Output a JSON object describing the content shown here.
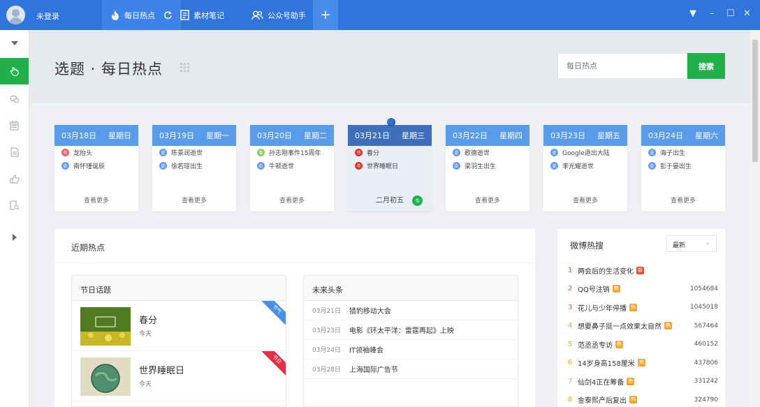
{
  "topbar": {
    "user": "未登录",
    "tabs": [
      {
        "label": "每日热点",
        "icon": "flame-icon"
      },
      {
        "label": "素材笔记",
        "icon": "note-icon"
      },
      {
        "label": "公众号助手",
        "icon": "users-icon"
      }
    ],
    "plus": "+",
    "window_controls": [
      "▼",
      "–",
      "☐",
      "✕"
    ]
  },
  "sidebar": {
    "items": [
      {
        "name": "collapse-arrow",
        "glyph": "▾"
      },
      {
        "name": "hot-topics",
        "glyph": "♨"
      },
      {
        "name": "chat",
        "glyph": "💬"
      },
      {
        "name": "calendar",
        "glyph": "📅"
      },
      {
        "name": "document",
        "glyph": "🗎"
      },
      {
        "name": "like",
        "glyph": "👍"
      },
      {
        "name": "search-doc",
        "glyph": "🔍"
      },
      {
        "name": "expand-arrow",
        "glyph": "▸"
      }
    ]
  },
  "header": {
    "title": "选题 · 每日热点",
    "search_placeholder": "每日热点",
    "search_button": "搜索"
  },
  "calendar": [
    {
      "date": "03月18日",
      "weekday": "星期日",
      "items": [
        {
          "badge": "节",
          "type": "jie",
          "text": "龙抬头"
        },
        {
          "badge": "史",
          "type": "shi",
          "text": "南怀瑾诞辰"
        }
      ],
      "more": "查看更多"
    },
    {
      "date": "03月19日",
      "weekday": "星期一",
      "items": [
        {
          "badge": "史",
          "type": "shi",
          "text": "陈景润逝世"
        },
        {
          "badge": "史",
          "type": "shi",
          "text": "徐若瑄出生"
        }
      ],
      "more": "查看更多"
    },
    {
      "date": "03月20日",
      "weekday": "星期二",
      "items": [
        {
          "badge": "事",
          "type": "shi2",
          "text": "孙志刚事件15周年"
        },
        {
          "badge": "史",
          "type": "shi",
          "text": "牛顿逝世"
        }
      ],
      "more": "查看更多"
    },
    {
      "date": "03月21日",
      "weekday": "星期三",
      "items": [
        {
          "badge": "节",
          "type": "red",
          "text": "春分"
        },
        {
          "badge": "节",
          "type": "red",
          "text": "世界睡眠日"
        }
      ],
      "lunar": "二月初五",
      "today_badge": "今"
    },
    {
      "date": "03月22日",
      "weekday": "星期四",
      "items": [
        {
          "badge": "史",
          "type": "shi",
          "text": "歌德逝世"
        },
        {
          "badge": "史",
          "type": "shi",
          "text": "梁羽生出生"
        }
      ],
      "more": "查看更多"
    },
    {
      "date": "03月23日",
      "weekday": "星期五",
      "items": [
        {
          "badge": "史",
          "type": "shi",
          "text": "Google退出大陆"
        },
        {
          "badge": "史",
          "type": "shi",
          "text": "李光耀逝世"
        }
      ],
      "more": "查看更多"
    },
    {
      "date": "03月24日",
      "weekday": "星期六",
      "items": [
        {
          "badge": "史",
          "type": "shi",
          "text": "海子出生"
        },
        {
          "badge": "史",
          "type": "shi",
          "text": "彭于晏出生"
        }
      ],
      "more": "查看更多"
    }
  ],
  "recent": {
    "title": "近期热点",
    "festival": {
      "title": "节日话题",
      "items": [
        {
          "title": "春分",
          "sub": "今天",
          "ribbon": "节气",
          "ribbon_color": "#4b8fe8"
        },
        {
          "title": "世界睡眠日",
          "sub": "今天",
          "ribbon": "节日",
          "ribbon_color": "#e0304a"
        }
      ]
    },
    "future": {
      "title": "未来头条",
      "items": [
        {
          "date": "03月21日",
          "text": "猎豹移动大会"
        },
        {
          "date": "03月23日",
          "text": "电影《环太平洋：雷霆再起》上映"
        },
        {
          "date": "03月24日",
          "text": "IT领袖峰会"
        },
        {
          "date": "03月28日",
          "text": "上海国际广告节"
        }
      ]
    }
  },
  "weibo": {
    "title": "微博热搜",
    "sort": "最新",
    "items": [
      {
        "rank": "1",
        "text": "两会后的生活变化",
        "tag": "新",
        "tag_color": "#e8502e",
        "count": ""
      },
      {
        "rank": "2",
        "text": "QQ号注销",
        "tag": "热",
        "tag_color": "#f2a52a",
        "count": "1054684"
      },
      {
        "rank": "3",
        "text": "花儿与少年停播",
        "tag": "热",
        "tag_color": "#f2a52a",
        "count": "1045018"
      },
      {
        "rank": "4",
        "text": "想要鼻子挺一点效果太自然",
        "tag": "热",
        "tag_color": "#f2a52a",
        "count": "567464"
      },
      {
        "rank": "5",
        "text": "范丞丞专访",
        "tag": "热",
        "tag_color": "#f2a52a",
        "count": "460152"
      },
      {
        "rank": "6",
        "text": "14岁身高158厘米",
        "tag": "热",
        "tag_color": "#f2a52a",
        "count": "437806"
      },
      {
        "rank": "7",
        "text": "仙剑4正在筹备",
        "tag": "热",
        "tag_color": "#f2a52a",
        "count": "331242"
      },
      {
        "rank": "8",
        "text": "金泰熙产后复出",
        "tag": "热",
        "tag_color": "#f2a52a",
        "count": "324790"
      }
    ]
  },
  "colors": {
    "accent": "#2f75dd",
    "green": "#22b04c",
    "rank_top": "#e8502e",
    "rank_other": "#f2a52a"
  }
}
